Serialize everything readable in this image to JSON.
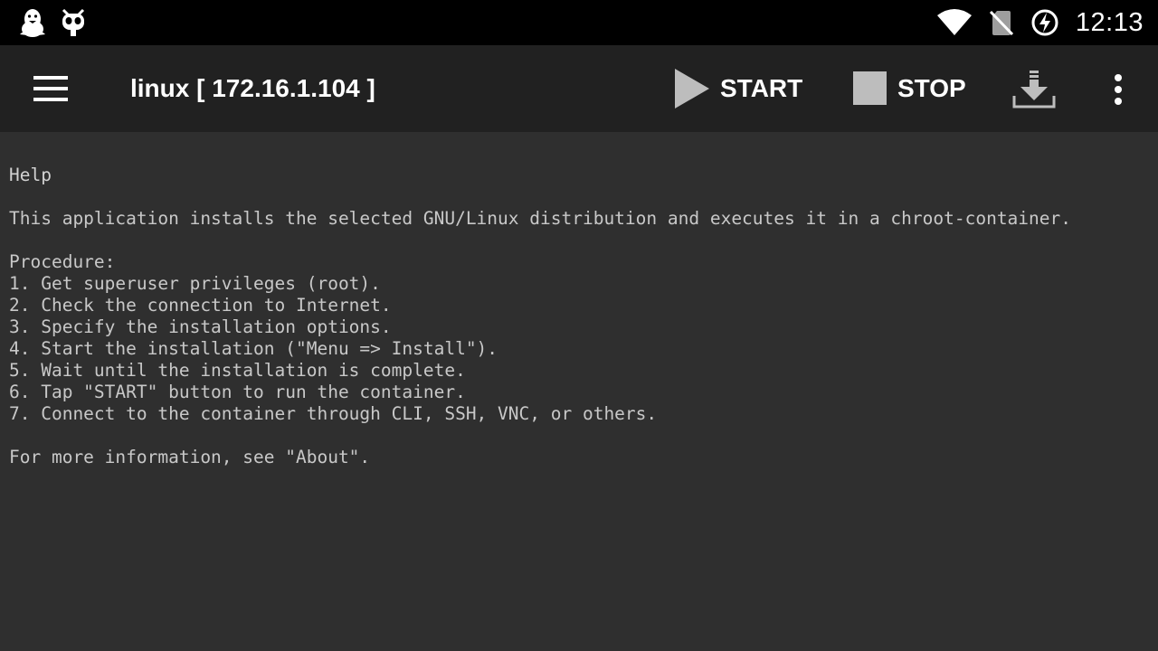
{
  "status_bar": {
    "time": "12:13",
    "icons": [
      "penguin-icon",
      "cyanogen-mascot-icon",
      "wifi-icon",
      "no-sim-icon",
      "battery-charging-icon"
    ]
  },
  "toolbar": {
    "title": "linux [ 172.16.1.104 ]",
    "start_label": "START",
    "stop_label": "STOP",
    "icons": [
      "hamburger-menu-icon",
      "play-icon",
      "stop-icon",
      "download-icon",
      "overflow-menu-icon"
    ]
  },
  "help": {
    "heading": "Help",
    "intro": "This application installs the selected GNU/Linux distribution and executes it in a chroot-container.",
    "procedure_label": "Procedure:",
    "steps": [
      "1. Get superuser privileges (root).",
      "2. Check the connection to Internet.",
      "3. Specify the installation options.",
      "4. Start the installation (\"Menu => Install\").",
      "5. Wait until the installation is complete.",
      "6. Tap \"START\" button to run the container.",
      "7. Connect to the container through CLI, SSH, VNC, or others."
    ],
    "footer": "For more information, see \"About\"."
  },
  "colors": {
    "status_bar_bg": "#000000",
    "toolbar_bg": "#212121",
    "content_bg": "#2f2f2f",
    "text": "#c8c8c8",
    "icon_gray": "#bdbdbd"
  }
}
